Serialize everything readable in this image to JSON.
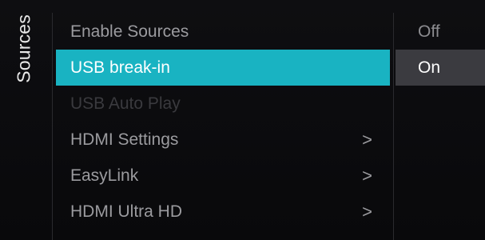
{
  "sidebar": {
    "title": "Sources"
  },
  "menu": {
    "items": [
      {
        "label": "Enable Sources",
        "state": "normal",
        "has_submenu": false
      },
      {
        "label": "USB break-in",
        "state": "selected",
        "has_submenu": false
      },
      {
        "label": "USB Auto Play",
        "state": "disabled",
        "has_submenu": false
      },
      {
        "label": "HDMI Settings",
        "state": "normal",
        "has_submenu": true,
        "chevron": ">"
      },
      {
        "label": "EasyLink",
        "state": "normal",
        "has_submenu": true,
        "chevron": ">"
      },
      {
        "label": "HDMI Ultra HD",
        "state": "normal",
        "has_submenu": true,
        "chevron": ">"
      }
    ]
  },
  "options": {
    "items": [
      {
        "label": "Off",
        "state": "normal"
      },
      {
        "label": "On",
        "state": "selected"
      }
    ]
  },
  "colors": {
    "background": "#0b0b0d",
    "highlight": "#19b3c2",
    "option_highlight": "#3b3b40",
    "text_normal": "#9b9b9f",
    "text_selected": "#ffffff",
    "text_disabled": "#3a3a3e"
  }
}
